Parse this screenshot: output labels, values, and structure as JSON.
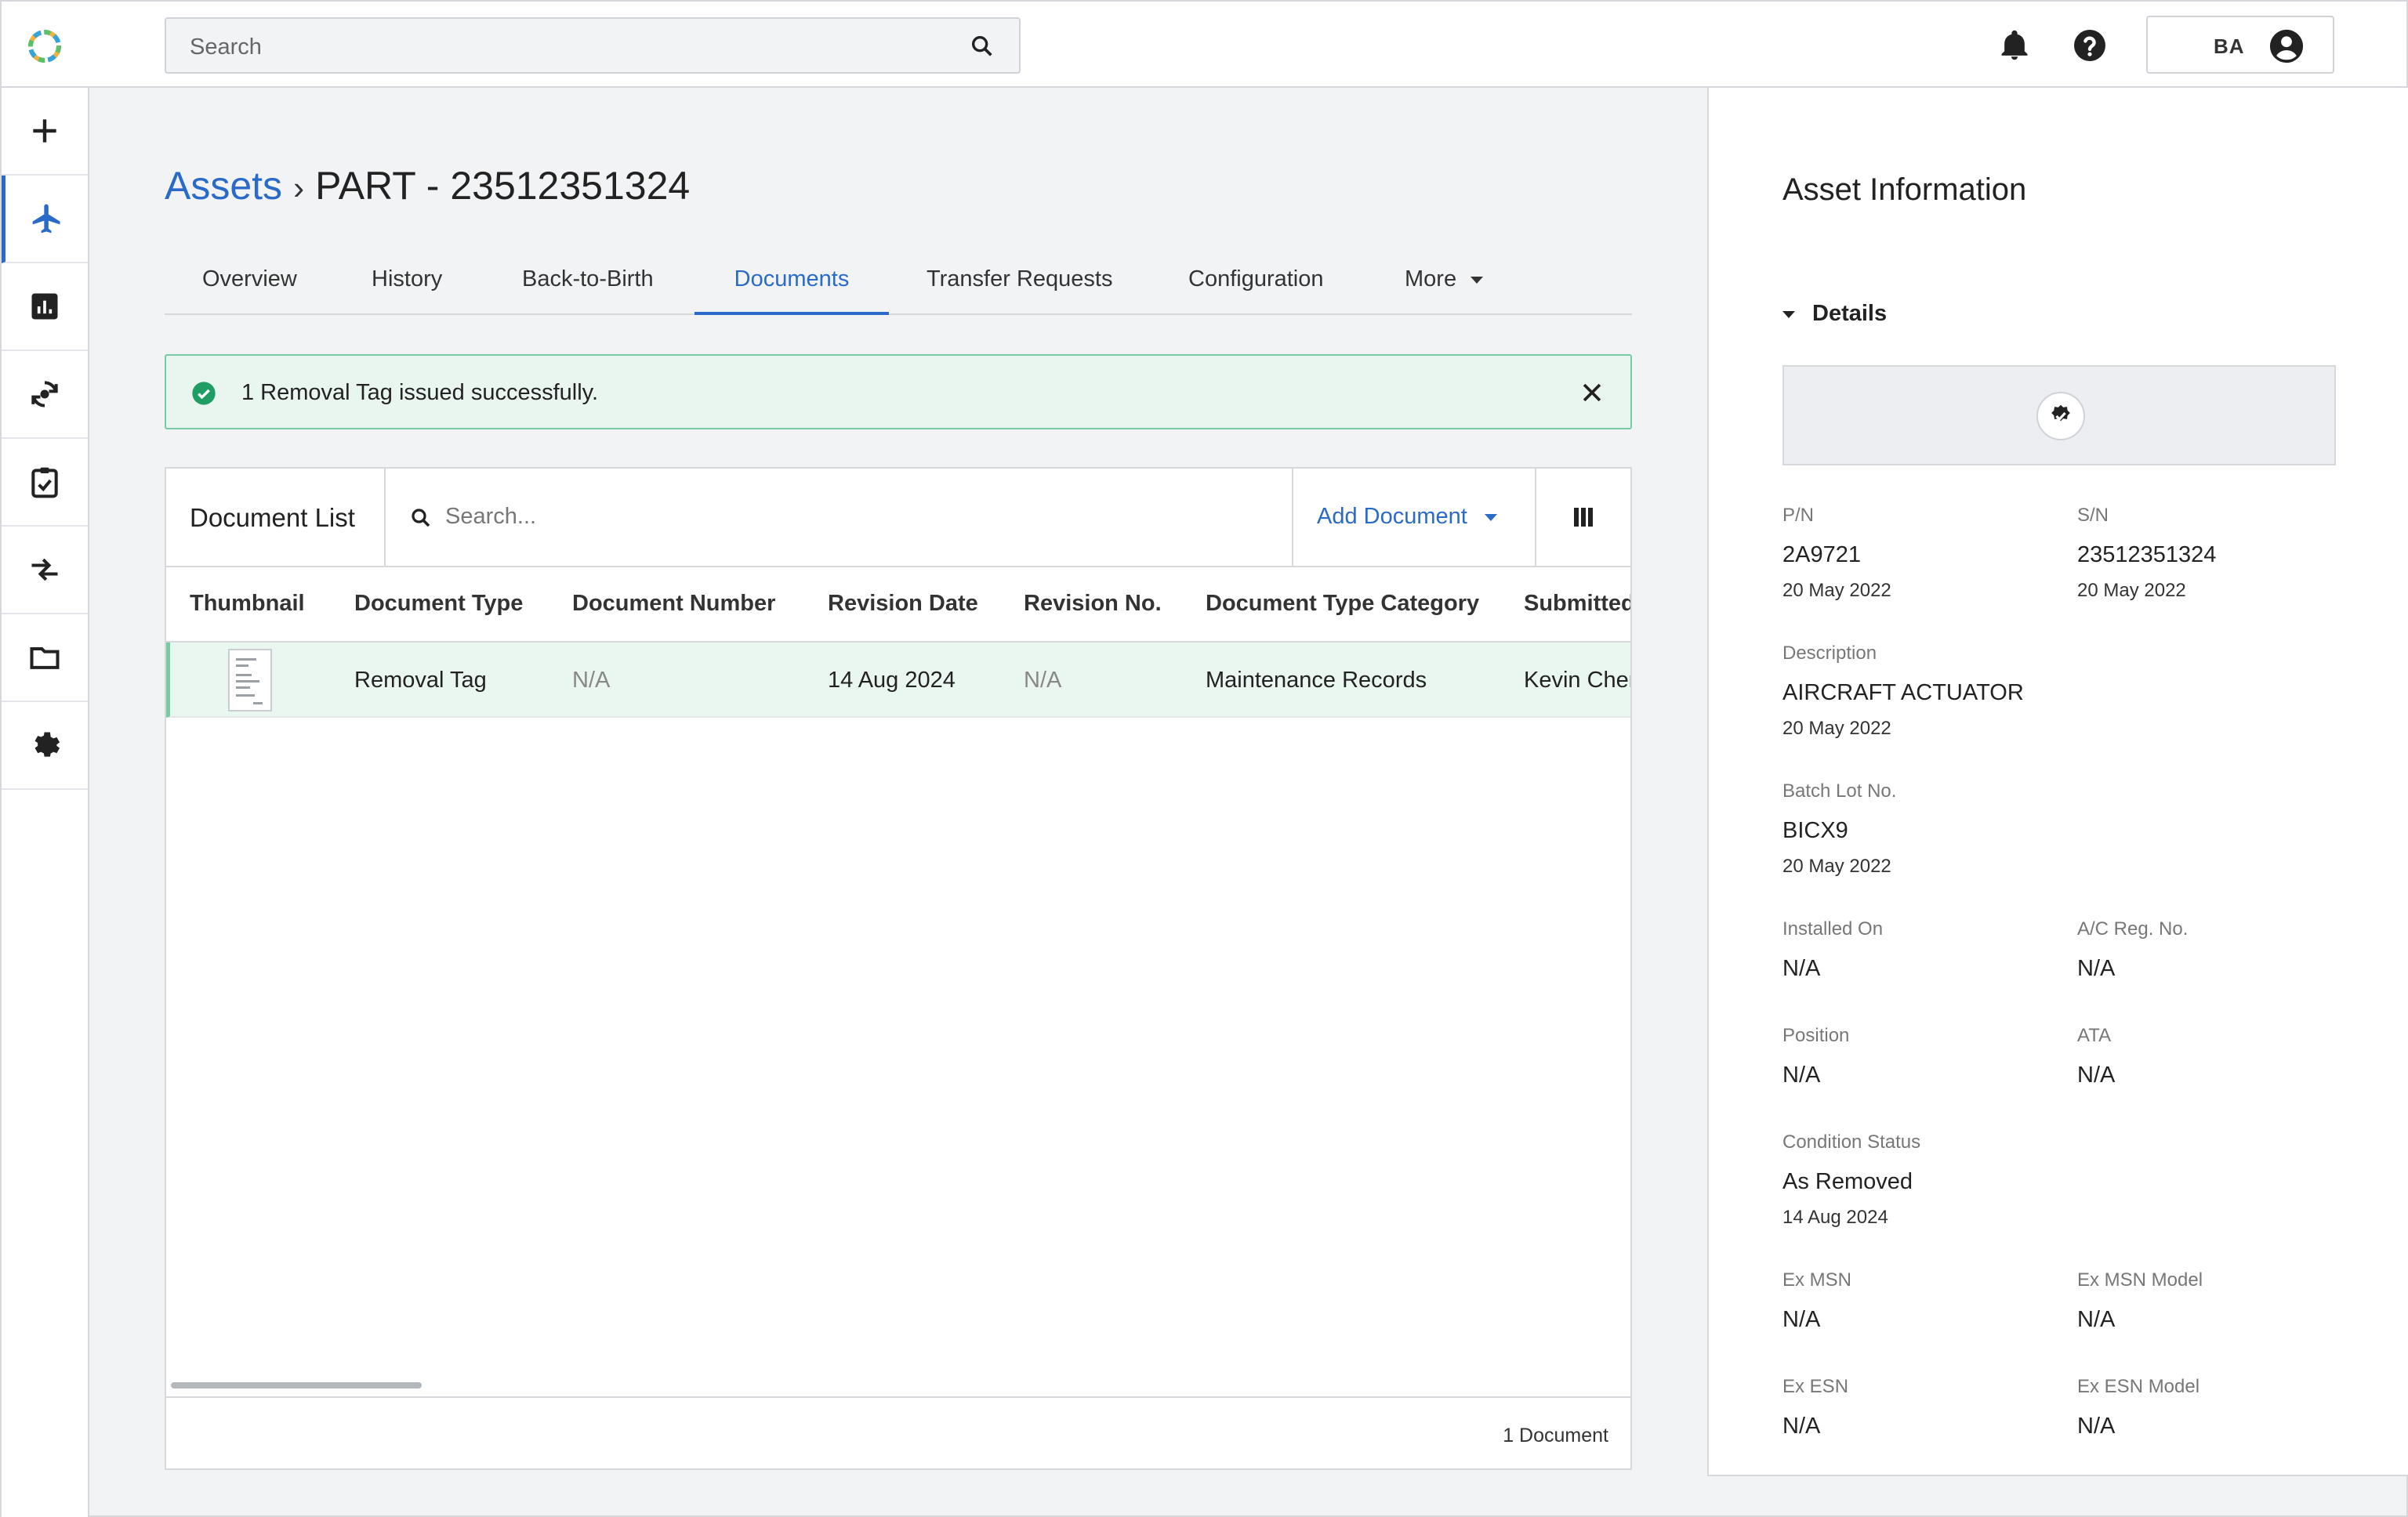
{
  "colors": {
    "accent": "#2a6ac8",
    "success": "#1e9e63",
    "success_bg": "#e9f6f0"
  },
  "topbar": {
    "search_placeholder": "Search",
    "user_initials": "BA",
    "icons": [
      "notifications-icon",
      "help-icon",
      "account-icon",
      "search-icon"
    ]
  },
  "rail": {
    "items": [
      {
        "icon": "plus-icon"
      },
      {
        "icon": "airplane-icon",
        "active": true
      },
      {
        "icon": "bar-chart-icon"
      },
      {
        "icon": "sync-icon"
      },
      {
        "icon": "clipboard-check-icon"
      },
      {
        "icon": "transfer-arrows-icon"
      },
      {
        "icon": "folder-icon"
      },
      {
        "icon": "settings-icon"
      }
    ]
  },
  "breadcrumb": {
    "root": "Assets",
    "separator": "›",
    "current": "PART - 23512351324"
  },
  "tabs": [
    {
      "label": "Overview"
    },
    {
      "label": "History"
    },
    {
      "label": "Back-to-Birth"
    },
    {
      "label": "Documents",
      "active": true
    },
    {
      "label": "Transfer Requests"
    },
    {
      "label": "Configuration"
    },
    {
      "label": "More"
    }
  ],
  "alert": {
    "message": "1 Removal Tag issued successfully."
  },
  "documents": {
    "title": "Document List",
    "search_placeholder": "Search...",
    "add_label": "Add Document",
    "columns": [
      "Thumbnail",
      "Document Type",
      "Document Number",
      "Revision Date",
      "Revision No.",
      "Document Type Category",
      "Submitted"
    ],
    "rows": [
      {
        "document_type": "Removal Tag",
        "document_number": "N/A",
        "revision_date": "14 Aug 2024",
        "revision_no": "N/A",
        "category": "Maintenance Records",
        "submitted_by": "Kevin Chen"
      }
    ],
    "footer_count": "1 Document"
  },
  "asset_info": {
    "title": "Asset Information",
    "section": "Details",
    "pn": {
      "label": "P/N",
      "value": "2A9721",
      "date": "20 May 2022"
    },
    "sn": {
      "label": "S/N",
      "value": "23512351324",
      "date": "20 May 2022"
    },
    "description": {
      "label": "Description",
      "value": "AIRCRAFT ACTUATOR",
      "date": "20 May 2022"
    },
    "batch": {
      "label": "Batch Lot No.",
      "value": "BICX9",
      "date": "20 May 2022"
    },
    "installed_on": {
      "label": "Installed On",
      "value": "N/A"
    },
    "ac_reg": {
      "label": "A/C Reg. No.",
      "value": "N/A"
    },
    "position": {
      "label": "Position",
      "value": "N/A"
    },
    "ata": {
      "label": "ATA",
      "value": "N/A"
    },
    "condition": {
      "label": "Condition Status",
      "value": "As Removed",
      "date": "14 Aug 2024"
    },
    "ex_msn": {
      "label": "Ex MSN",
      "value": "N/A"
    },
    "ex_msn_model": {
      "label": "Ex MSN Model",
      "value": "N/A"
    },
    "ex_esn": {
      "label": "Ex ESN",
      "value": "N/A"
    },
    "ex_esn_model": {
      "label": "Ex ESN Model",
      "value": "N/A"
    }
  }
}
